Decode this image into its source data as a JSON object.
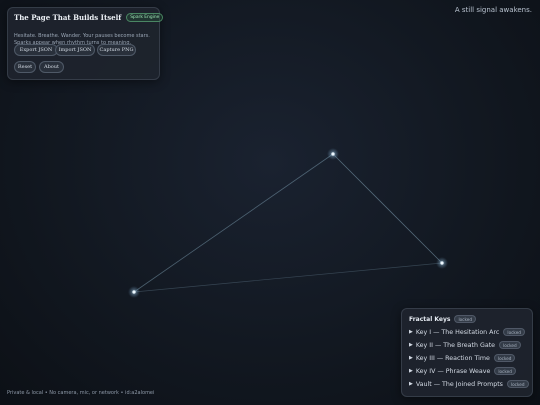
{
  "status_text": "A still signal awakens.",
  "panel": {
    "title": "The Page That Builds Itself",
    "badge": "Spark Engine",
    "description": "Hesitate. Breathe. Wander. Your pauses become stars. Sparks appear when rhythm turns to meaning.",
    "buttons": {
      "export": "Export JSON",
      "import": "Import JSON",
      "capture": "Capture PNG",
      "reset": "Reset",
      "about": "About"
    }
  },
  "keys_panel": {
    "title": "Fractal Keys",
    "title_badge": "locked",
    "items": [
      {
        "label": "Key I — The Hesitation Arc",
        "status": "locked"
      },
      {
        "label": "Key II — The Breath Gate",
        "status": "locked"
      },
      {
        "label": "Key III — Reaction Time",
        "status": "locked"
      },
      {
        "label": "Key IV — Phrase Weave",
        "status": "locked"
      },
      {
        "label": "Vault — The Joined Prompts",
        "status": "locked"
      }
    ]
  },
  "footer": "Private & local • No camera, mic, or network • id:a2alomei",
  "colors": {
    "background": "#121821",
    "star": "#d8ecff",
    "link": "#8fb4c8",
    "badge_green": "#9be3b3"
  }
}
